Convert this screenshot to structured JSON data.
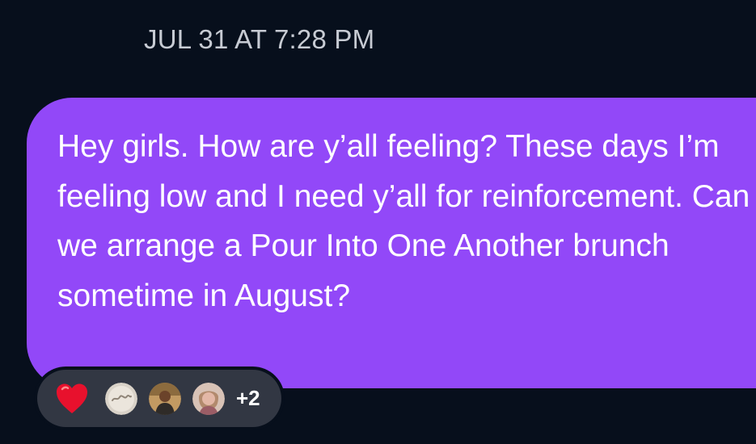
{
  "conversation": {
    "timestamp": "JUL 31 AT 7:28 PM"
  },
  "message": {
    "text": "Hey girls. How are y’all feeling? These days I’m feeling low and I need y’all for reinforcement. Can we arrange a Pour Into One Another brunch sometime in August?",
    "bubble_color": "#9248f8"
  },
  "reactions": {
    "emoji_icon": "red-heart-icon",
    "reactor_avatars": [
      "smile-avatar",
      "reactor-avatar-2",
      "reactor-avatar-3"
    ],
    "more_count": "+2",
    "pill_color": "#323743"
  },
  "theme": {
    "background": "#070f1c",
    "timestamp_color": "#c7cbd3",
    "text_color": "#ffffff"
  }
}
